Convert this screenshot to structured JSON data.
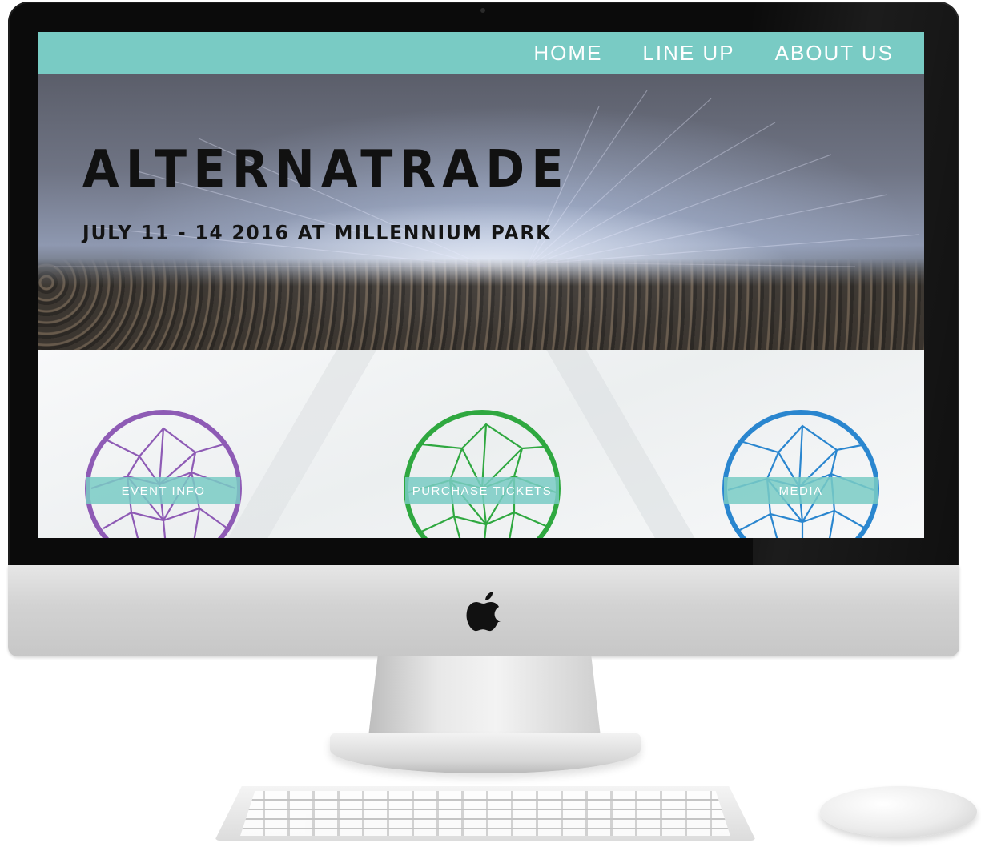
{
  "nav": {
    "items": [
      {
        "label": "HOME"
      },
      {
        "label": "LINE UP"
      },
      {
        "label": "ABOUT US"
      }
    ]
  },
  "hero": {
    "title": "ALTERNATRADE",
    "subtitle": "JULY 11 - 14 2016 AT MILLENNIUM PARK"
  },
  "buttons": [
    {
      "label": "EVENT INFO",
      "color": "#8e5bb5"
    },
    {
      "label": "PURCHASE TICKETS",
      "color": "#2fa840"
    },
    {
      "label": "MEDIA",
      "color": "#2a86cf"
    }
  ],
  "colors": {
    "accent": "#79cbc4",
    "bezel": "#0b0b0b"
  },
  "icons": {
    "brand": "apple-logo-icon"
  }
}
